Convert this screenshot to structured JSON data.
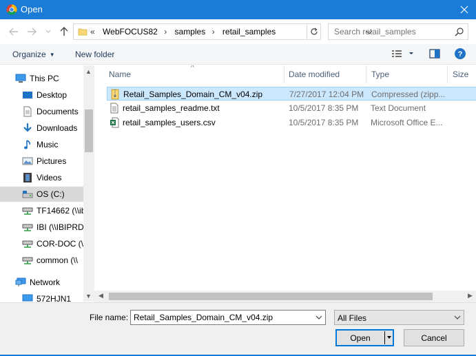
{
  "window": {
    "title": "Open",
    "accent_color": "#1a7cd6"
  },
  "address": {
    "overflow": "«",
    "crumbs": [
      "WebFOCUS82",
      "samples",
      "retail_samples"
    ],
    "search_placeholder": "Search retail_samples"
  },
  "toolbar": {
    "organize_label": "Organize",
    "new_folder_label": "New folder"
  },
  "nav": {
    "items": [
      {
        "label": "This PC",
        "icon": "computer-icon"
      },
      {
        "label": "Desktop",
        "icon": "desktop-icon"
      },
      {
        "label": "Documents",
        "icon": "documents-icon"
      },
      {
        "label": "Downloads",
        "icon": "downloads-icon"
      },
      {
        "label": "Music",
        "icon": "music-icon"
      },
      {
        "label": "Pictures",
        "icon": "pictures-icon"
      },
      {
        "label": "Videos",
        "icon": "videos-icon"
      },
      {
        "label": "OS (C:)",
        "icon": "drive-icon"
      },
      {
        "label": "TF14662 (\\\\ib",
        "icon": "network-drive-icon"
      },
      {
        "label": "IBI (\\\\IBIPRD/",
        "icon": "network-drive-icon"
      },
      {
        "label": "COR-DOC (\\\\",
        "icon": "network-drive-icon"
      },
      {
        "label": "common (\\\\",
        "icon": "network-drive-icon"
      },
      {
        "label": "Network",
        "icon": "network-icon"
      },
      {
        "label": "572HJN1",
        "icon": "computer-icon"
      }
    ],
    "selected_index": 7
  },
  "columns": {
    "name": "Name",
    "date": "Date modified",
    "type": "Type",
    "size": "Size"
  },
  "files": [
    {
      "name": "Retail_Samples_Domain_CM_v04.zip",
      "date": "7/27/2017 12:04 PM",
      "type": "Compressed (zipp...",
      "icon": "zip-icon",
      "selected": true
    },
    {
      "name": "retail_samples_readme.txt",
      "date": "10/5/2017 8:35 PM",
      "type": "Text Document",
      "icon": "text-file-icon",
      "selected": false
    },
    {
      "name": "retail_samples_users.csv",
      "date": "10/5/2017 8:35 PM",
      "type": "Microsoft Office E...",
      "icon": "excel-file-icon",
      "selected": false
    }
  ],
  "bottom": {
    "file_name_label": "File name:",
    "file_name_value": "Retail_Samples_Domain_CM_v04.zip",
    "file_type_value": "All Files",
    "open_label": "Open",
    "cancel_label": "Cancel"
  }
}
